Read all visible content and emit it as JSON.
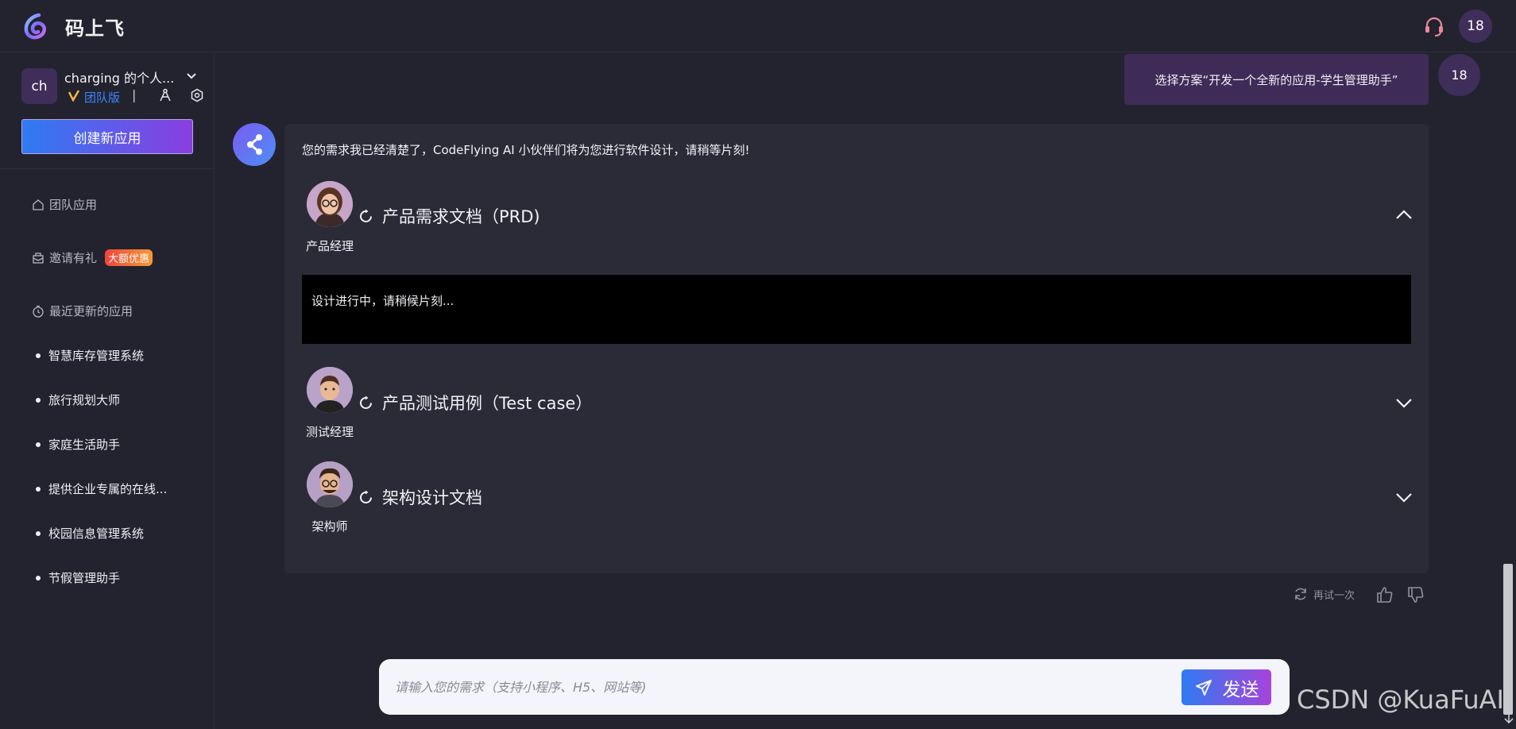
{
  "header": {
    "app_title": "码上飞",
    "user_badge": "18"
  },
  "workspace": {
    "avatar": "ch",
    "name": "charging 的个人...",
    "plan": "团队版",
    "separator": "|"
  },
  "sidebar": {
    "create_button": "创建新应用",
    "nav": [
      {
        "label": "团队应用",
        "icon": "home-icon"
      },
      {
        "label": "邀请有礼",
        "icon": "gift-icon",
        "badge": "大额优惠"
      },
      {
        "label": "最近更新的应用",
        "icon": "clock-icon"
      }
    ],
    "recent_apps": [
      "智慧库存管理系统",
      "旅行规划大师",
      "家庭生活助手",
      "提供企业专属的在线...",
      "校园信息管理系统",
      "节假管理助手"
    ]
  },
  "chat": {
    "user_message": "选择方案“开发一个全新的应用-学生管理助手”",
    "user_avatar": "18",
    "bot_intro": "您的需求我已经清楚了，CodeFlying AI 小伙伴们将为您进行软件设计，请稍等片刻!",
    "agents": [
      {
        "role": "产品经理",
        "title": "产品需求文档（PRD)",
        "expanded": true,
        "content": "设计进行中，请稍候片刻..."
      },
      {
        "role": "测试经理",
        "title": "产品测试用例（Test case）",
        "expanded": false
      },
      {
        "role": "架构师",
        "title": "架构设计文档",
        "expanded": false
      }
    ],
    "retry_label": "再试一次"
  },
  "input": {
    "placeholder": "请输入您的需求（支持小程序、H5、网站等)",
    "send_label": "发送"
  },
  "watermark": "CSDN @KuaFuAI",
  "colors": {
    "accent_blue": "#2f7bf2",
    "accent_purple": "#8a3ee0",
    "bg": "#23232f",
    "card": "#2b2b38"
  }
}
